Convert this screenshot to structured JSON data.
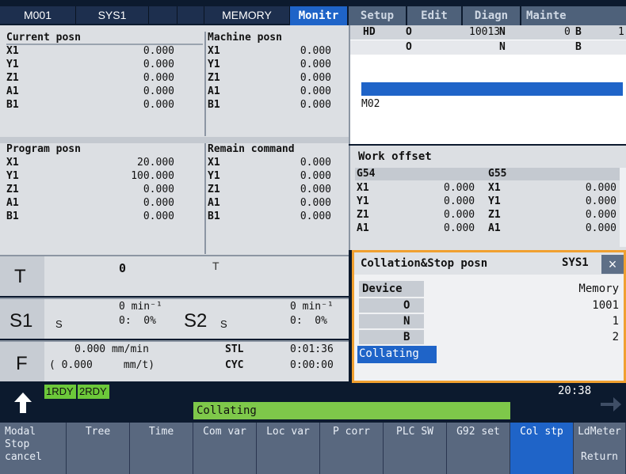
{
  "header": {
    "mode_code": "M001",
    "system": "SYS1",
    "status": "MEMORY",
    "tabs": [
      "Monitr",
      "Setup",
      "Edit",
      "Diagn",
      "Mainte"
    ]
  },
  "current_posn": {
    "title": "Current posn",
    "axes": [
      {
        "axis": "X1",
        "value": "0.000"
      },
      {
        "axis": "Y1",
        "value": "0.000"
      },
      {
        "axis": "Z1",
        "value": "0.000"
      },
      {
        "axis": "A1",
        "value": "0.000"
      },
      {
        "axis": "B1",
        "value": "0.000"
      }
    ]
  },
  "machine_posn": {
    "title": "Machine posn",
    "axes": [
      {
        "axis": "X1",
        "value": "0.000"
      },
      {
        "axis": "Y1",
        "value": "0.000"
      },
      {
        "axis": "Z1",
        "value": "0.000"
      },
      {
        "axis": "A1",
        "value": "0.000"
      },
      {
        "axis": "B1",
        "value": "0.000"
      }
    ]
  },
  "program_posn": {
    "title": "Program posn",
    "axes": [
      {
        "axis": "X1",
        "value": "20.000"
      },
      {
        "axis": "Y1",
        "value": "100.000"
      },
      {
        "axis": "Z1",
        "value": "0.000"
      },
      {
        "axis": "A1",
        "value": "0.000"
      },
      {
        "axis": "B1",
        "value": "0.000"
      }
    ]
  },
  "remain_command": {
    "title": "Remain command",
    "axes": [
      {
        "axis": "X1",
        "value": "0.000"
      },
      {
        "axis": "Y1",
        "value": "0.000"
      },
      {
        "axis": "Z1",
        "value": "0.000"
      },
      {
        "axis": "A1",
        "value": "0.000"
      },
      {
        "axis": "B1",
        "value": "0.000"
      }
    ]
  },
  "program_header": {
    "hd": "HD",
    "o_label": "O",
    "o_value": "10013",
    "n_label": "N",
    "n_value": "0",
    "b_label": "B",
    "b_value": "1",
    "row2_o": "O",
    "row2_n": "N",
    "row2_b": "B",
    "block_text": "M02"
  },
  "work_offset": {
    "title": "Work offset",
    "col1": "G54",
    "col2": "G55",
    "rows": [
      {
        "axis": "X1",
        "v1": "0.000",
        "axis2": "X1",
        "v2": "0.000"
      },
      {
        "axis": "Y1",
        "v1": "0.000",
        "axis2": "Y1",
        "v2": "0.000"
      },
      {
        "axis": "Z1",
        "v1": "0.000",
        "axis2": "Z1",
        "v2": "0.000"
      },
      {
        "axis": "A1",
        "v1": "0.000",
        "axis2": "A1",
        "v2": "0.000"
      }
    ]
  },
  "tool": {
    "t_label": "T",
    "t_value": "0",
    "t2_label": "T"
  },
  "spindle": {
    "s1_label": "S1",
    "s1_small": "S",
    "s1_speed": "0 min⁻¹",
    "s1_pct": "0:  0%",
    "s2_label": "S2",
    "s2_small": "S",
    "s2_speed": "0 min⁻¹",
    "s2_pct": "0:  0%"
  },
  "feed": {
    "f_label": "F",
    "f_value": "0.000 mm/min",
    "f_sub": "( 0.000     mm/t)",
    "stl_label": "STL",
    "stl_value": "0:01:36",
    "cyc_label": "CYC",
    "cyc_value": "0:00:00"
  },
  "popup": {
    "title": "Collation&Stop posn",
    "system": "SYS1",
    "close": "×",
    "device_label": "Device",
    "device_value": "Memory",
    "rows": [
      {
        "label": "O",
        "value": "1001"
      },
      {
        "label": "N",
        "value": "1"
      },
      {
        "label": "B",
        "value": "2"
      }
    ],
    "status": "Collating"
  },
  "status_bar": {
    "rdy1": "1RDY",
    "rdy2": "2RDY",
    "time": "20:38",
    "message": "Collating"
  },
  "softkeys": [
    {
      "label": "Modal\nStop\ncancel"
    },
    {
      "label": "Tree"
    },
    {
      "label": "Time"
    },
    {
      "label": "Com var"
    },
    {
      "label": "Loc var"
    },
    {
      "label": "P corr"
    },
    {
      "label": "PLC SW"
    },
    {
      "label": "G92 set"
    },
    {
      "label": "Col stp"
    },
    {
      "label": "LdMeter\n\nReturn"
    }
  ],
  "colors": {
    "accent_blue": "#1f64c8",
    "popup_border": "#f0a030",
    "ready_green": "#6cc83a",
    "message_green": "#7ec84a",
    "header_bg": "#1d2f4e"
  }
}
